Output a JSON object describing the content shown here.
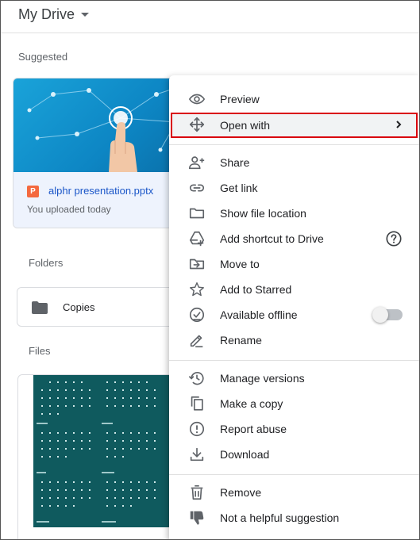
{
  "header": {
    "title": "My Drive"
  },
  "sections": {
    "suggested": "Suggested",
    "folders": "Folders",
    "files": "Files"
  },
  "suggested_card": {
    "badge": "P",
    "file_name": "alphr presentation.pptx",
    "subtitle": "You uploaded today"
  },
  "folder": {
    "name": "Copies"
  },
  "context_menu": {
    "items": [
      {
        "label": "Preview",
        "icon": "eye-icon"
      },
      {
        "label": "Open with",
        "icon": "move-arrows-icon",
        "has_submenu": true,
        "highlighted": true
      },
      {
        "label": "Share",
        "icon": "person-add-icon"
      },
      {
        "label": "Get link",
        "icon": "link-icon"
      },
      {
        "label": "Show file location",
        "icon": "folder-icon"
      },
      {
        "label": "Add shortcut to Drive",
        "icon": "drive-shortcut-icon",
        "has_help": true
      },
      {
        "label": "Move to",
        "icon": "move-to-folder-icon"
      },
      {
        "label": "Add to Starred",
        "icon": "star-icon"
      },
      {
        "label": "Available offline",
        "icon": "offline-check-icon",
        "toggle": false
      },
      {
        "label": "Rename",
        "icon": "pencil-icon"
      },
      {
        "label": "Manage versions",
        "icon": "history-icon"
      },
      {
        "label": "Make a copy",
        "icon": "copy-icon"
      },
      {
        "label": "Report abuse",
        "icon": "report-icon"
      },
      {
        "label": "Download",
        "icon": "download-icon"
      },
      {
        "label": "Remove",
        "icon": "trash-icon"
      },
      {
        "label": "Not a helpful suggestion",
        "icon": "thumbs-down-icon"
      }
    ]
  },
  "colors": {
    "highlight_border": "#d9000d",
    "link_blue": "#1a56c8",
    "ppt_orange": "#f4693f"
  }
}
